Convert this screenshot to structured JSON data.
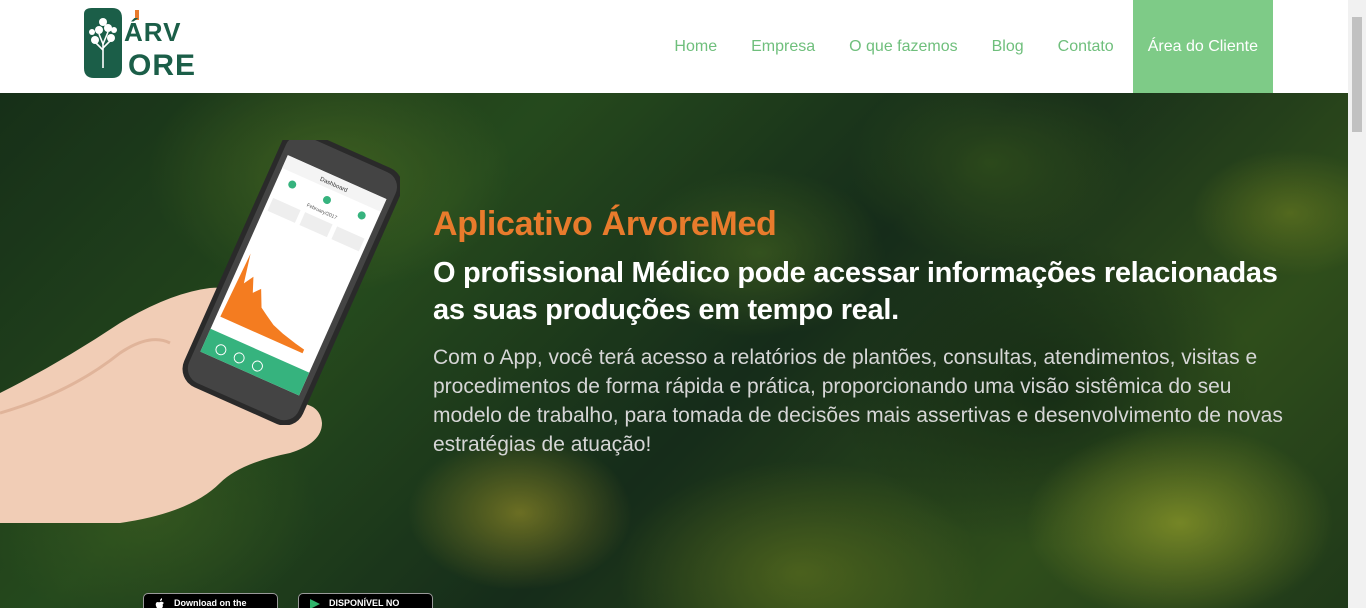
{
  "brand": {
    "logo_text_top": "ÁRV",
    "logo_text_bottom": "ORE",
    "primary_color": "#1b5e48",
    "accent_color": "#e87b2c",
    "nav_color": "#6fbf7c",
    "cta_color": "#7ecb87"
  },
  "nav": {
    "items": [
      {
        "label": "Home"
      },
      {
        "label": "Empresa"
      },
      {
        "label": "O que fazemos"
      },
      {
        "label": "Blog"
      },
      {
        "label": "Contato"
      }
    ],
    "cta_label": "Área do Cliente"
  },
  "hero": {
    "kicker": "Aplicativo ÁrvoreMed",
    "headline": "O profissional Médico pode acessar informações relacionadas as suas produções em tempo real.",
    "body": "Com o App, você terá acesso a relatórios de plantões, consultas, atendimentos, visitas e procedimentos de forma rápida e prática, proporcionando uma visão sistêmica do seu modelo de trabalho, para tomada de decisões mais assertivas e desenvolvimento de novas estratégias de atuação!",
    "phone_screen": {
      "title": "Dashboard",
      "month": "February/2017"
    }
  },
  "stores": {
    "apple_label": "Download on the",
    "google_label": "DISPONÍVEL NO"
  }
}
